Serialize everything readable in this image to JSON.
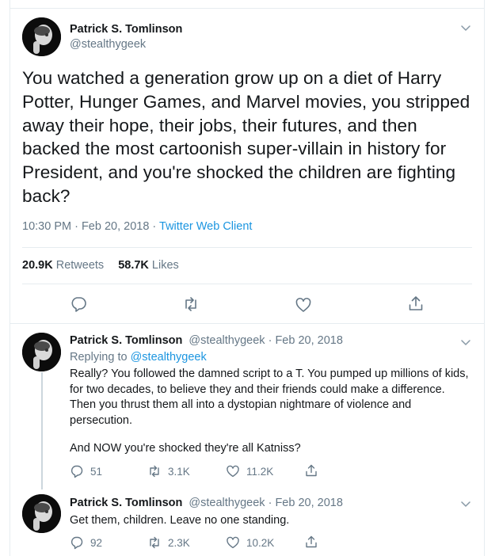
{
  "main": {
    "name": "Patrick S. Tomlinson",
    "handle": "@stealthygeek",
    "text": "You watched a generation grow up on a diet of Harry Potter, Hunger Games, and Marvel movies, you stripped away their hope, their jobs, their futures, and then backed the most cartoonish super-villain in history for President, and you're shocked the children are fighting back?",
    "timestamp": "10:30 PM · Feb 20, 2018 · ",
    "client": "Twitter Web Client",
    "retweets_count": "20.9K",
    "retweets_label": "Retweets",
    "likes_count": "58.7K",
    "likes_label": "Likes"
  },
  "replies": [
    {
      "name": "Patrick S. Tomlinson",
      "meta": "@stealthygeek · Feb 20, 2018",
      "replying_label": "Replying to ",
      "replying_to": "@stealthygeek",
      "text1": "Really? You followed the damned script to a T. You pumped up millions of kids, for two decades, to believe they and their friends could make a difference. Then you thrust them all into a dystopian nightmare of violence and persecution.",
      "text2": "And NOW you're shocked they're all Katniss?",
      "reply_count": "51",
      "retweet_count": "3.1K",
      "like_count": "11.2K"
    },
    {
      "name": "Patrick S. Tomlinson",
      "meta": "@stealthygeek · Feb 20, 2018",
      "text1": "Get them, children. Leave no one standing.",
      "reply_count": "92",
      "retweet_count": "2.3K",
      "like_count": "10.2K"
    }
  ],
  "icons": {
    "reply": "reply-icon",
    "retweet": "retweet-icon",
    "like": "heart-icon",
    "share": "share-icon",
    "more": "chevron-down-icon"
  },
  "colors": {
    "text": "#14171a",
    "secondary": "#657786",
    "link": "#1b95e0",
    "border": "#e6ecf0"
  }
}
